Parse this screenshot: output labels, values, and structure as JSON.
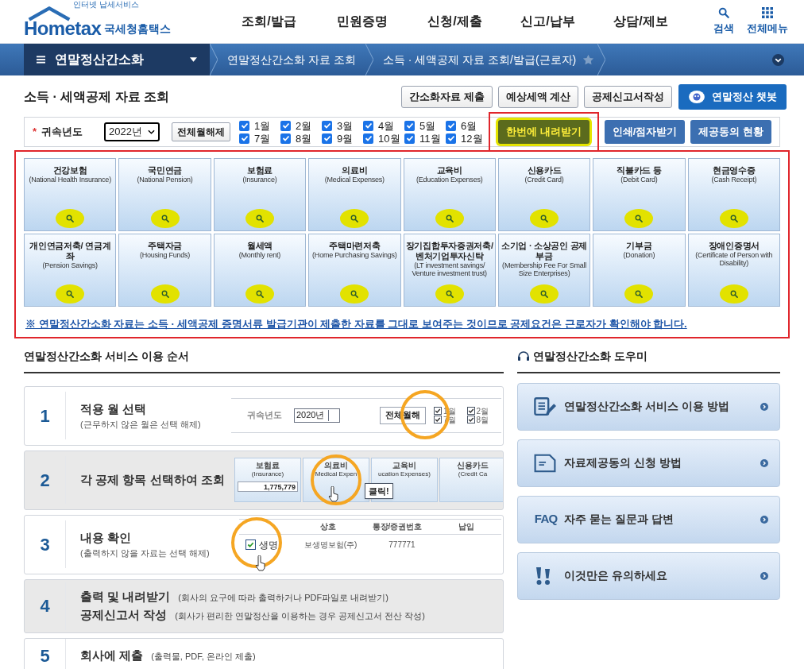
{
  "logo": {
    "tagline": "인터넷 납세서비스",
    "wordmark": "Hometax",
    "name": "국세청홈택스"
  },
  "menu": [
    "조회/발급",
    "민원증명",
    "신청/제출",
    "신고/납부",
    "상담/제보"
  ],
  "tools": [
    "검색",
    "전체메뉴"
  ],
  "breadcrumb": {
    "menu": "연말정산간소화",
    "crumbs": [
      "연말정산간소화 자료 조회",
      "소득 · 세액공제 자료 조회/발급(근로자)"
    ],
    "favorite": false
  },
  "page_title": "소득 · 세액공제 자료 조회",
  "actions": [
    "간소화자료 제출",
    "예상세액 계산",
    "공제신고서작성"
  ],
  "chatbot": "연말정산 챗봇",
  "filter": {
    "required_mark": "*",
    "label": "귀속년도",
    "year": "2022년",
    "clear_button": "전체월해제",
    "months": [
      {
        "label": "1월",
        "checked": true
      },
      {
        "label": "2월",
        "checked": true
      },
      {
        "label": "3월",
        "checked": true
      },
      {
        "label": "4월",
        "checked": true
      },
      {
        "label": "5월",
        "checked": true
      },
      {
        "label": "6월",
        "checked": true
      },
      {
        "label": "7월",
        "checked": true
      },
      {
        "label": "8월",
        "checked": true
      },
      {
        "label": "9월",
        "checked": true
      },
      {
        "label": "10월",
        "checked": true
      },
      {
        "label": "11월",
        "checked": true
      },
      {
        "label": "12월",
        "checked": true
      }
    ],
    "buttons": [
      {
        "label": "한번에 내려받기",
        "highlighted": true,
        "outlined": true
      },
      {
        "label": "인쇄/점자받기",
        "highlighted": false,
        "outlined": false
      },
      {
        "label": "제공동의 현황",
        "highlighted": false,
        "outlined": false
      }
    ]
  },
  "categories": {
    "outlined": true,
    "tiles": [
      {
        "title": "건강보험",
        "subtitle": "(National Health Insurance)",
        "highlighted": true
      },
      {
        "title": "국민연금",
        "subtitle": "(National Pension)",
        "highlighted": true
      },
      {
        "title": "보험료",
        "subtitle": "(Insurance)",
        "highlighted": true
      },
      {
        "title": "의료비",
        "subtitle": "(Medical Expenses)",
        "highlighted": true
      },
      {
        "title": "교육비",
        "subtitle": "(Education Expenses)",
        "highlighted": true
      },
      {
        "title": "신용카드",
        "subtitle": "(Credit Card)",
        "highlighted": true
      },
      {
        "title": "직불카드 등",
        "subtitle": "(Debit Card)",
        "highlighted": true
      },
      {
        "title": "현금영수증",
        "subtitle": "(Cash Receipt)",
        "highlighted": true
      },
      {
        "title": "개인연금저축/ 연금계좌",
        "subtitle": "(Pension Savings)",
        "highlighted": true
      },
      {
        "title": "주택자금",
        "subtitle": "(Housing Funds)",
        "highlighted": true
      },
      {
        "title": "월세액",
        "subtitle": "(Monthly rent)",
        "highlighted": true
      },
      {
        "title": "주택마련저축",
        "subtitle": "(Home Purchasing Savings)",
        "highlighted": true
      },
      {
        "title": "장기집합투자증권저축/ 벤처기업투자신탁",
        "subtitle": "(LT investment savings/ Venture investment trust)",
        "highlighted": true
      },
      {
        "title": "소기업 · 소상공인 공제부금",
        "subtitle": "(Membership Fee For Small Size Enterprises)",
        "highlighted": true
      },
      {
        "title": "기부금",
        "subtitle": "(Donation)",
        "highlighted": true
      },
      {
        "title": "장애인증명서",
        "subtitle": "(Certificate of Person with Disability)",
        "highlighted": true
      }
    ],
    "notice": "※ 연말정산간소화 자료는 소득 · 세액공제 증명서류 발급기관이 제출한 자료를 그대로 보여주는 것이므로 공제요건은 근로자가 확인해야 합니다."
  },
  "steps_title": "연말정산간소화 서비스 이용 순서",
  "steps": [
    {
      "number": "1",
      "shaded": false,
      "lines": [
        {
          "title": "적용 월 선택",
          "note": "(근무하지 않은 월은 선택 해제)"
        }
      ],
      "illustration": {
        "kind": "months",
        "label": "귀속년도",
        "year": "2020년",
        "button": "전체월해",
        "checks": [
          {
            "label": "1월",
            "checked": true
          },
          {
            "label": "2월",
            "checked": true
          },
          {
            "label": "7월",
            "checked": true
          },
          {
            "label": "8월",
            "checked": true
          }
        ]
      }
    },
    {
      "number": "2",
      "shaded": true,
      "lines": [
        {
          "title": "각 공제 항목 선택하여 조회"
        }
      ],
      "illustration": {
        "kind": "tiles",
        "callout": "클릭!",
        "tiles": [
          {
            "title": "보험료",
            "subtitle": "(Insurance)",
            "amount": "1,775,779"
          },
          {
            "title": "의료비",
            "subtitle": "Medical Expen"
          },
          {
            "title": "교육비",
            "subtitle": "ucation Expenses)"
          },
          {
            "title": "신용카드",
            "subtitle": "(Credit Ca"
          }
        ]
      }
    },
    {
      "number": "3",
      "shaded": false,
      "lines": [
        {
          "title": "내용 확인",
          "note": "(출력하지 않을 자료는 선택 해제)"
        }
      ],
      "illustration": {
        "kind": "table",
        "columns": [
          "상호",
          "통장/증권번호",
          "납입"
        ],
        "rows": [
          {
            "checked": true,
            "magnified": "생명",
            "cells": [
              "보생명보험(주)",
              "777771"
            ]
          }
        ]
      }
    },
    {
      "number": "4",
      "shaded": true,
      "inline": true,
      "lines": [
        {
          "title": "출력 및 내려받기",
          "note": "(회사의 요구에 따라 출력하거나 PDF파일로 내려받기)"
        },
        {
          "title": "공제신고서 작성",
          "note": "(회사가 편리한 연말정산을 이용하는 경우 공제신고서 전산 작성)"
        }
      ]
    },
    {
      "number": "5",
      "shaded": false,
      "inline": true,
      "lines": [
        {
          "title": "회사에 제출",
          "note": "(출력물, PDF, 온라인 제출)"
        }
      ]
    }
  ],
  "helper_title": "연말정산간소화 도우미",
  "helpers": [
    {
      "label": "연말정산간소화 서비스 이용 방법"
    },
    {
      "label": "자료제공동의 신청 방법"
    },
    {
      "icon_text": "FAQ",
      "label": "자주 묻는 질문과 답변"
    },
    {
      "label": "이것만은 유의하세요"
    }
  ]
}
